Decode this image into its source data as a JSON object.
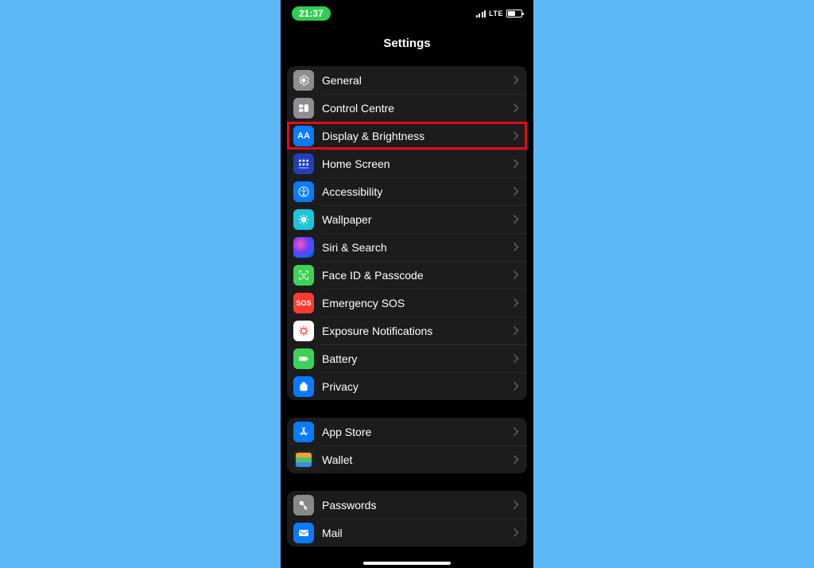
{
  "statusBar": {
    "time": "21:37",
    "network": "LTE"
  },
  "pageTitle": "Settings",
  "groups": [
    {
      "items": [
        {
          "id": "general",
          "label": "General",
          "highlighted": false
        },
        {
          "id": "control-centre",
          "label": "Control Centre",
          "highlighted": false
        },
        {
          "id": "display-brightness",
          "label": "Display & Brightness",
          "highlighted": true
        },
        {
          "id": "home-screen",
          "label": "Home Screen",
          "highlighted": false
        },
        {
          "id": "accessibility",
          "label": "Accessibility",
          "highlighted": false
        },
        {
          "id": "wallpaper",
          "label": "Wallpaper",
          "highlighted": false
        },
        {
          "id": "siri-search",
          "label": "Siri & Search",
          "highlighted": false
        },
        {
          "id": "face-id-passcode",
          "label": "Face ID & Passcode",
          "highlighted": false
        },
        {
          "id": "emergency-sos",
          "label": "Emergency SOS",
          "highlighted": false
        },
        {
          "id": "exposure-notifications",
          "label": "Exposure Notifications",
          "highlighted": false
        },
        {
          "id": "battery",
          "label": "Battery",
          "highlighted": false
        },
        {
          "id": "privacy",
          "label": "Privacy",
          "highlighted": false
        }
      ]
    },
    {
      "items": [
        {
          "id": "app-store",
          "label": "App Store",
          "highlighted": false
        },
        {
          "id": "wallet",
          "label": "Wallet",
          "highlighted": false
        }
      ]
    },
    {
      "items": [
        {
          "id": "passwords",
          "label": "Passwords",
          "highlighted": false
        },
        {
          "id": "mail",
          "label": "Mail",
          "highlighted": false
        }
      ]
    }
  ]
}
